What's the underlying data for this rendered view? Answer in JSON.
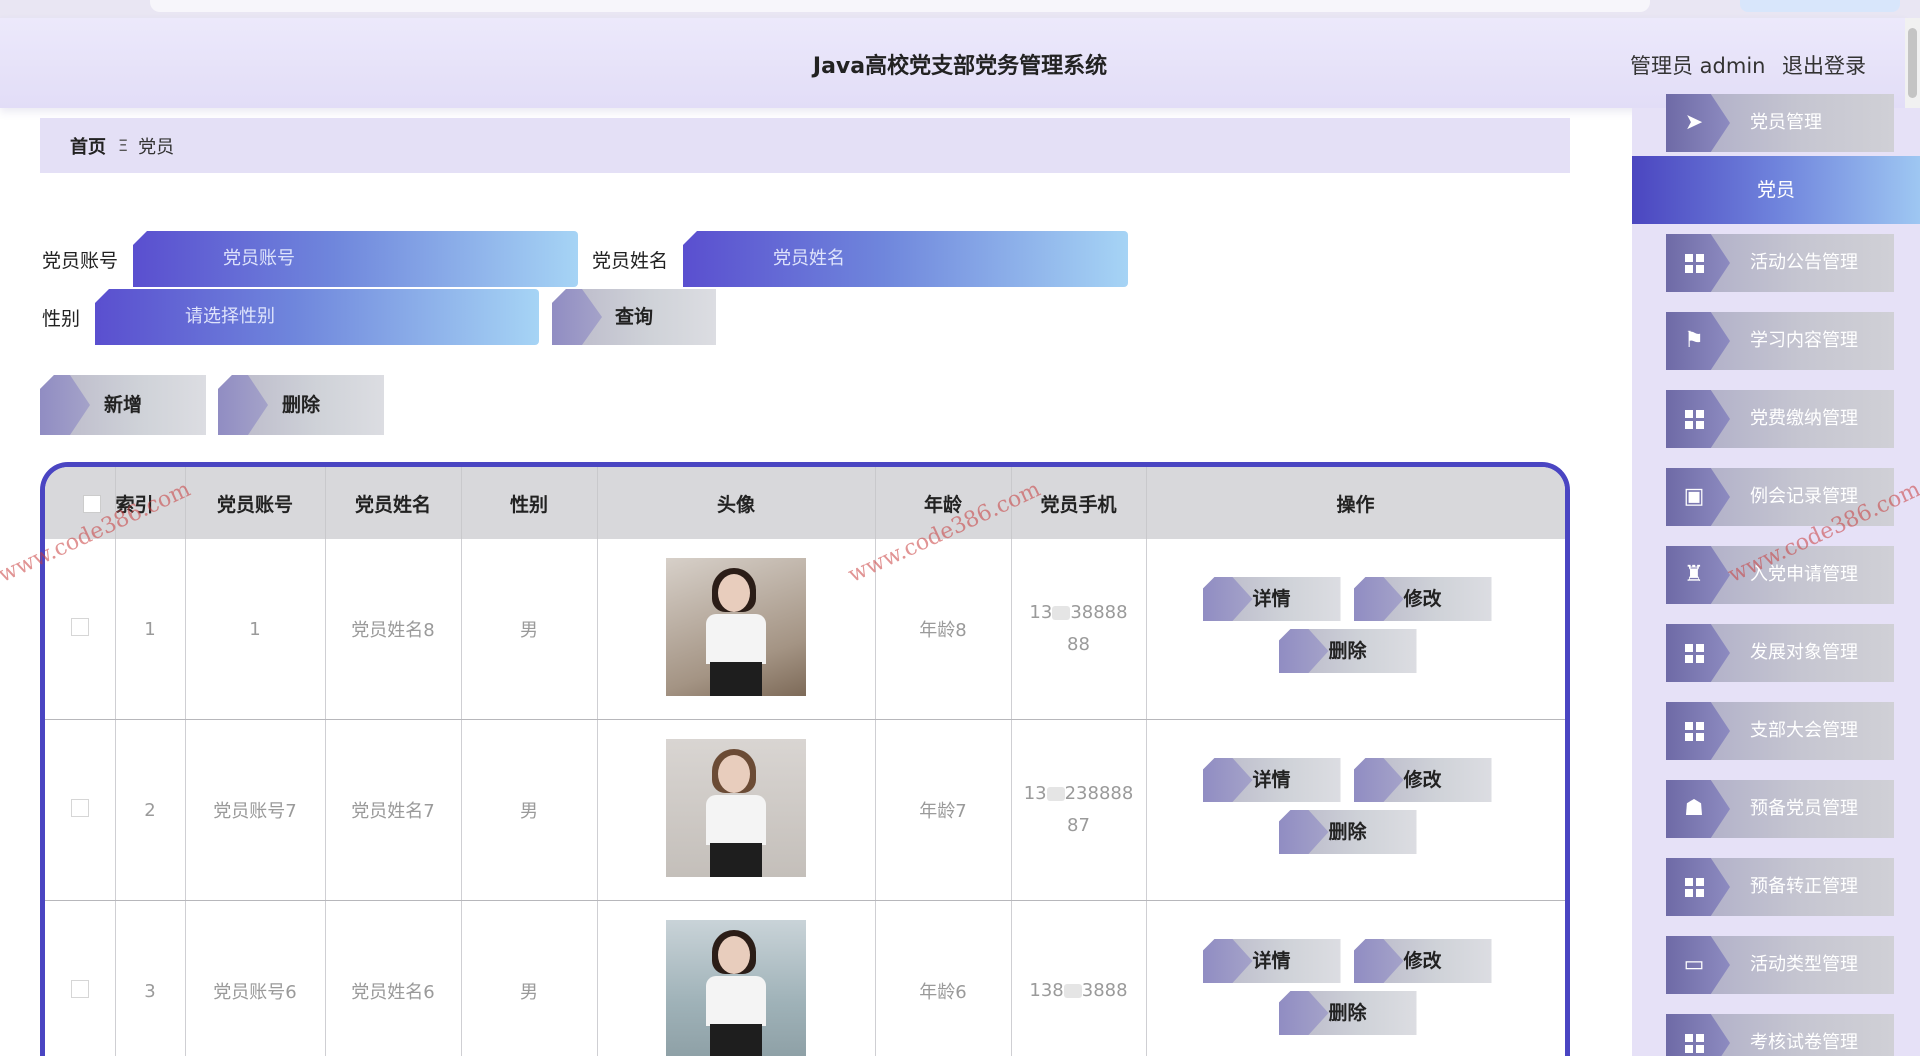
{
  "app": {
    "title": "Java高校党支部党务管理系统",
    "user_label": "管理员 admin",
    "logout": "退出登录"
  },
  "breadcrumb": {
    "home": "首页",
    "separator": "Ξ",
    "current": "党员"
  },
  "search": {
    "account_label": "党员账号",
    "account_placeholder": "党员账号",
    "name_label": "党员姓名",
    "name_placeholder": "党员姓名",
    "gender_label": "性别",
    "gender_placeholder": "请选择性别",
    "query_button": "查询"
  },
  "actions": {
    "add": "新增",
    "delete": "删除"
  },
  "table": {
    "headers": [
      "索引",
      "党员账号",
      "党员姓名",
      "性别",
      "头像",
      "年龄",
      "党员手机",
      "操作"
    ],
    "rows": [
      {
        "index": "1",
        "account": "1",
        "name": "党员姓名8",
        "gender": "男",
        "age": "年龄8",
        "phone_a": "13",
        "phone_b": "38888",
        "phone_c": "88"
      },
      {
        "index": "2",
        "account": "党员账号7",
        "name": "党员姓名7",
        "gender": "男",
        "age": "年龄7",
        "phone_a": "13",
        "phone_b": "238888",
        "phone_c": "87"
      },
      {
        "index": "3",
        "account": "党员账号6",
        "name": "党员姓名6",
        "gender": "男",
        "age": "年龄6",
        "phone_a": "138",
        "phone_b": "3888",
        "phone_c": ""
      }
    ],
    "op_detail": "详情",
    "op_edit": "修改",
    "op_delete": "删除"
  },
  "sidebar": {
    "group_title": "党员管理",
    "active": "党员",
    "items": [
      {
        "label": "活动公告管理",
        "icon": "grid-icon"
      },
      {
        "label": "学习内容管理",
        "icon": "flag-icon"
      },
      {
        "label": "党费缴纳管理",
        "icon": "grid-icon"
      },
      {
        "label": "例会记录管理",
        "icon": "briefcase-icon"
      },
      {
        "label": "入党申请管理",
        "icon": "cup-icon"
      },
      {
        "label": "发展对象管理",
        "icon": "grid-icon"
      },
      {
        "label": "支部大会管理",
        "icon": "grid-icon"
      },
      {
        "label": "预备党员管理",
        "icon": "person-icon"
      },
      {
        "label": "预备转正管理",
        "icon": "grid-icon"
      },
      {
        "label": "活动类型管理",
        "icon": "monitor-icon"
      },
      {
        "label": "考核试卷管理",
        "icon": "grid-icon"
      }
    ]
  },
  "watermark": "www.code386.com",
  "colors": {
    "accent": "#4a45c2",
    "gradient_end": "#9ec7f2",
    "header_bg": "#e4e0f6"
  }
}
